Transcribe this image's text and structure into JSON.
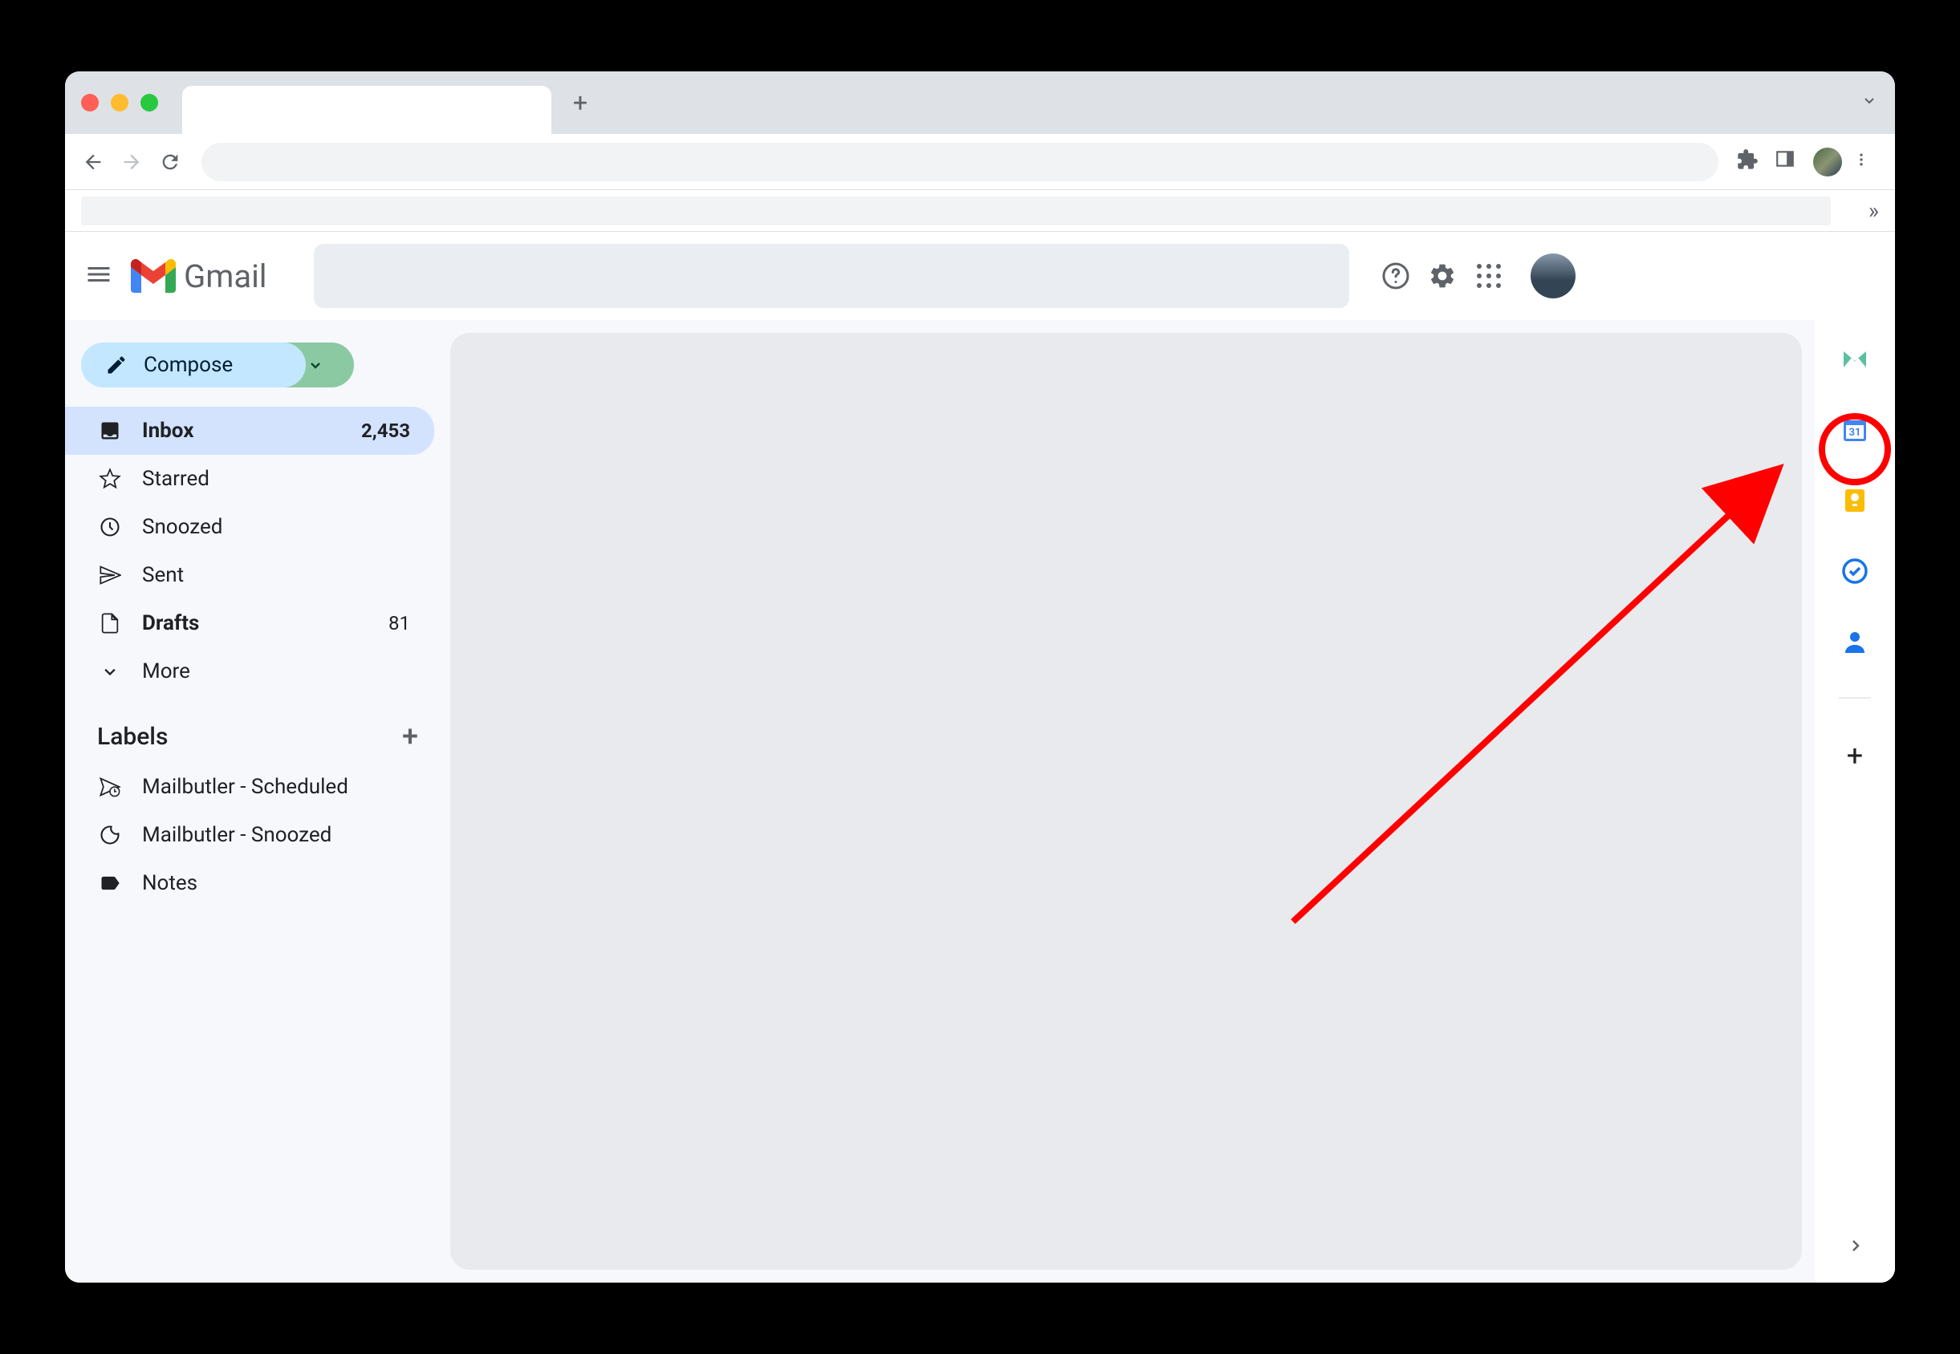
{
  "app_name": "Gmail",
  "compose_label": "Compose",
  "sidebar": {
    "inbox": {
      "label": "Inbox",
      "count": "2,453"
    },
    "starred": {
      "label": "Starred"
    },
    "snoozed": {
      "label": "Snoozed"
    },
    "sent": {
      "label": "Sent"
    },
    "drafts": {
      "label": "Drafts",
      "count": "81"
    },
    "more": {
      "label": "More"
    }
  },
  "labels_header": "Labels",
  "labels": {
    "scheduled": "Mailbutler - Scheduled",
    "snoozed": "Mailbutler - Snoozed",
    "notes": "Notes"
  },
  "side_panel": {
    "calendar_day": "31"
  }
}
